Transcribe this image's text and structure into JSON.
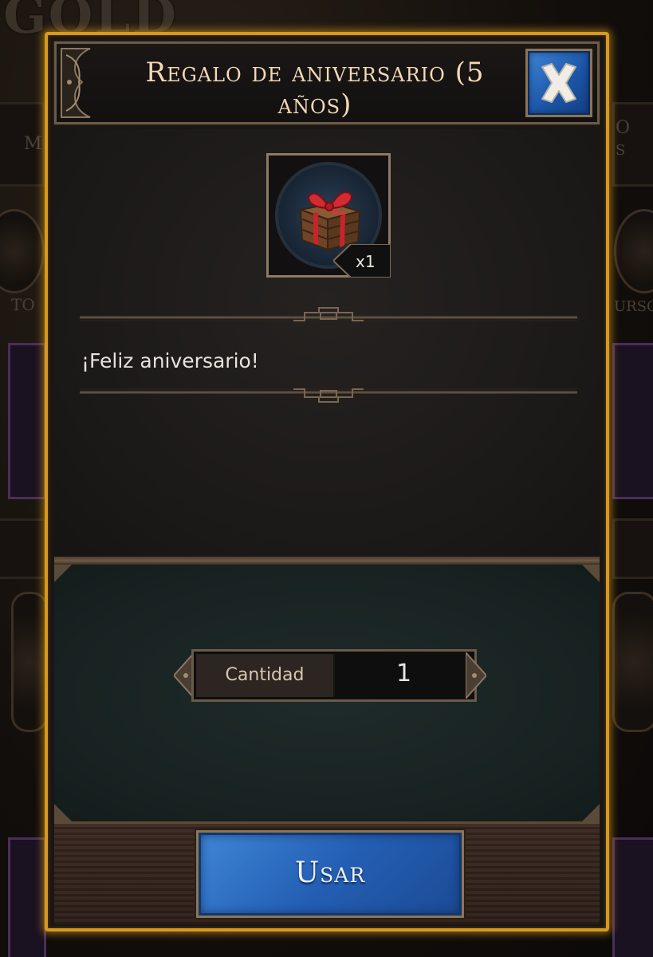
{
  "background": {
    "logo_text": "GOLD",
    "left_words": [
      "M",
      "TO"
    ],
    "right_words": [
      "O",
      "S",
      "URSO"
    ]
  },
  "dialog": {
    "title": "Regalo de aniversario (5 años)",
    "close_icon": "close-x-icon",
    "item": {
      "icon": "gift-box-icon",
      "quantity_badge": "x1"
    },
    "message": "¡Feliz aniversario!",
    "quantity": {
      "label": "Cantidad",
      "value": "1"
    },
    "use_button": "Usar"
  },
  "colors": {
    "frame_gold": "#d79a1e",
    "button_blue": "#245fb4",
    "title_text": "#f3d8b6"
  }
}
